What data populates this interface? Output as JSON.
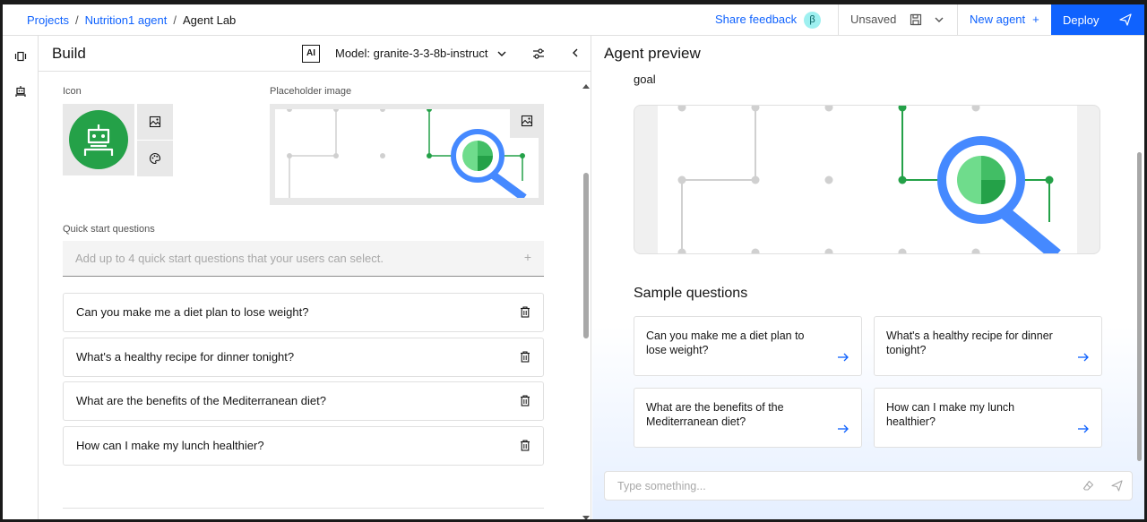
{
  "breadcrumb": {
    "items": [
      "Projects",
      "Nutrition1 agent"
    ],
    "separator": "/",
    "current": "Agent Lab"
  },
  "header": {
    "share_feedback": "Share feedback",
    "beta_badge": "β",
    "save_status": "Unsaved",
    "new_agent": "New agent",
    "new_agent_plus": "+",
    "deploy": "Deploy"
  },
  "rail": {
    "icons": [
      "compare-icon",
      "agent-bot-icon"
    ]
  },
  "build": {
    "title": "Build",
    "ai_badge": "AI",
    "model_label": "Model: granite-3-3-8b-instruct",
    "icon_label": "Icon",
    "placeholder_image_label": "Placeholder image",
    "quick_start_label": "Quick start questions",
    "quick_start_placeholder": "Add up to 4 quick start questions that your users can select.",
    "quick_start_plus": "+",
    "questions": [
      "Can you make me a diet plan to lose weight?",
      "What's a healthy recipe for dinner tonight?",
      "What are the benefits of the Mediterranean diet?",
      "How can I make my lunch healthier?"
    ]
  },
  "preview": {
    "title": "Agent preview",
    "goal_text": "goal",
    "sample_title": "Sample questions",
    "samples": [
      "Can you make me a diet plan to lose weight?",
      "What's a healthy recipe for dinner tonight?",
      "What are the benefits of the Mediterranean diet?",
      "How can I make my lunch healthier?"
    ],
    "chat_placeholder": "Type something..."
  },
  "colors": {
    "accent": "#0f62fe",
    "agent_icon_bg": "#24a148",
    "beta_bg": "#9ef0f0"
  }
}
